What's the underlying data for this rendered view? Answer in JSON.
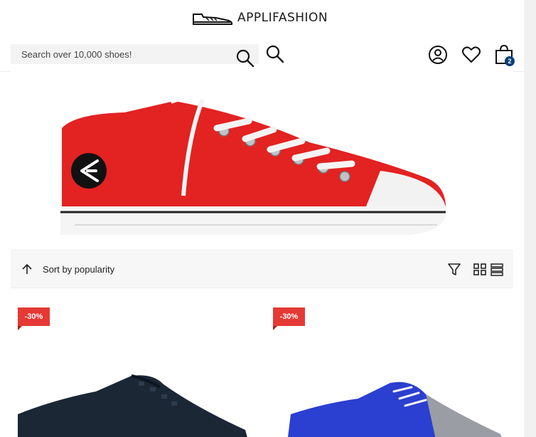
{
  "header": {
    "brand": "APPLIFASHION",
    "search_placeholder": "Search over 10,000 shoes!",
    "cart_count": "2",
    "icons": [
      "logo-shoe-icon",
      "search-icon",
      "account-icon",
      "wishlist-icon",
      "cart-icon"
    ]
  },
  "hero": {
    "image": "red-canvas-sneaker"
  },
  "toolbar": {
    "sort_label": "Sort by popularity",
    "icons": [
      "sort-up-arrow-icon",
      "filter-icon",
      "grid-view-icon",
      "list-view-icon"
    ]
  },
  "products": [
    {
      "discount": "-30%",
      "image": "navy-suede-shoe"
    },
    {
      "discount": "-30%",
      "image": "blue-suede-glitter-shoe"
    }
  ],
  "colors": {
    "accent": "#e53935",
    "badge": "#0a3f7a"
  }
}
